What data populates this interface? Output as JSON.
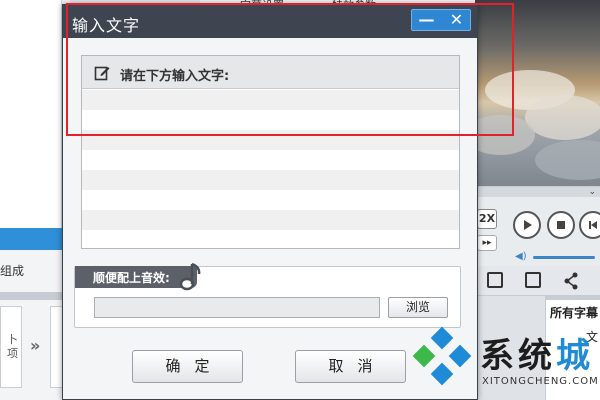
{
  "background": {
    "left_label": "组成",
    "left_card_text": "卜\n项",
    "tabs": [
      "字幕设置",
      "特效参数"
    ],
    "playback": {
      "speed_label": "2X",
      "ff_label": "▸▸"
    },
    "subtitle_panel": {
      "header": "所有字幕",
      "row": "文"
    }
  },
  "dialog": {
    "title": "输入文字",
    "window_buttons": {
      "minimize": "—",
      "close": "✕"
    },
    "input": {
      "label": "请在下方输入文字:",
      "line_count": 8
    },
    "audio": {
      "label": "顺便配上音效:",
      "path_value": "",
      "browse_label": "浏览"
    },
    "buttons": {
      "ok": "确定",
      "cancel": "取消"
    }
  },
  "watermark": {
    "text_main": "系统",
    "text_accent": "城",
    "url": "XITONGCHENG.COM",
    "colors": [
      "#1f8ad6",
      "#3cb94a",
      "#1f8ad6",
      "#1f8ad6"
    ]
  },
  "colors": {
    "titlebar": "#3e4550",
    "window_button": "#2f86d3",
    "highlight": "#e3212b",
    "audio_tab": "#5b6069"
  }
}
